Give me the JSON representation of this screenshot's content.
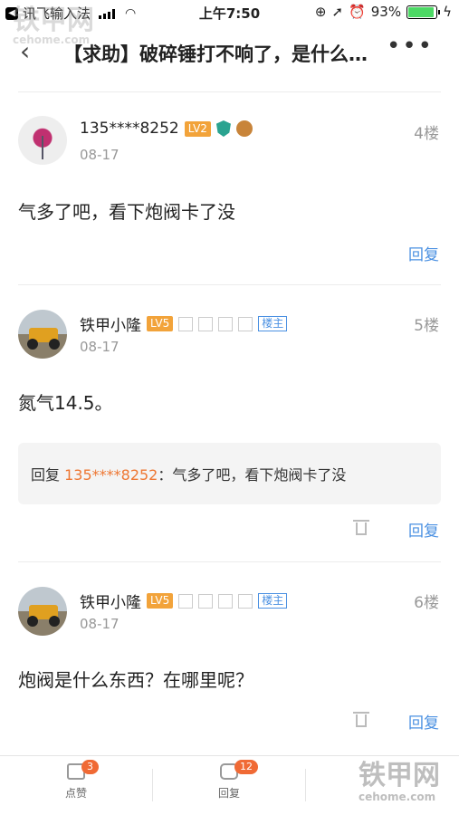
{
  "status_bar": {
    "back_app": "讯飞输入法",
    "time": "上午7:50",
    "battery": "93%",
    "battery_level": 0.93
  },
  "nav": {
    "title": "【求助】破碎锤打不响了，是什么原因"
  },
  "watermark": {
    "brand": "铁甲网",
    "domain": "cehome.com"
  },
  "posts": [
    {
      "username": "135****8252",
      "level": "LV2",
      "date": "08-17",
      "floor": "4楼",
      "content": "气多了吧，看下炮阀卡了没",
      "reply_label": "回复"
    },
    {
      "username": "铁甲小隆",
      "level": "LV5",
      "owner_tag": "楼主",
      "date": "08-17",
      "floor": "5楼",
      "content": "氮气14.5。",
      "quote": {
        "prefix": "回复 ",
        "user": "135****8252",
        "text": "：气多了吧，看下炮阀卡了没"
      },
      "reply_label": "回复"
    },
    {
      "username": "铁甲小隆",
      "level": "LV5",
      "owner_tag": "楼主",
      "date": "08-17",
      "floor": "6楼",
      "content": "炮阀是什么东西？在哪里呢？",
      "reply_label": "回复"
    }
  ],
  "tabbar": {
    "like_label": "点赞",
    "like_count": "3",
    "reply_label": "回复",
    "reply_count": "12"
  },
  "colors": {
    "accent": "#4a90e2",
    "level_badge": "#f2a33a",
    "quote_user": "#ee7733",
    "count_badge": "#f06a35"
  }
}
